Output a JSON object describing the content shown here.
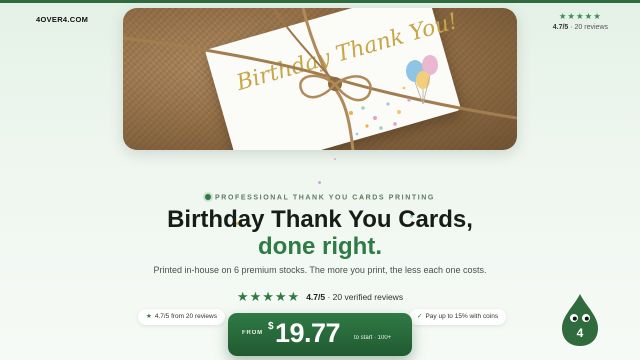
{
  "brand": {
    "logo": "4OVER4.COM"
  },
  "hero": {
    "card_text": "Birthday Thank You!"
  },
  "top_rating": {
    "stars": "★★★★★",
    "score": "4.7/5",
    "count": "· 20 reviews"
  },
  "eyebrow": "PROFESSIONAL THANK YOU CARDS PRINTING",
  "headline": {
    "line1": "Birthday Thank You Cards,",
    "line2": "done right."
  },
  "subtitle": "Printed in-house on 6 premium stocks. The more you print, the less each one costs.",
  "reviews": {
    "stars": "★★★★★",
    "score": "4.7/5",
    "detail": "· 20 verified reviews"
  },
  "pills": {
    "left": {
      "icon": "★",
      "text": "4.7/5 from 20 reviews"
    },
    "right": {
      "icon": "✓",
      "text": "Pay up to 15% with coins"
    }
  },
  "cta": {
    "from": "FROM",
    "currency": "$",
    "price": "19.77",
    "note": "to start · 100+"
  },
  "mascot": {
    "label": "4"
  },
  "colors": {
    "brand_green": "#2f7a45",
    "dark_green": "#215a31",
    "gold": "#c7a64a"
  }
}
